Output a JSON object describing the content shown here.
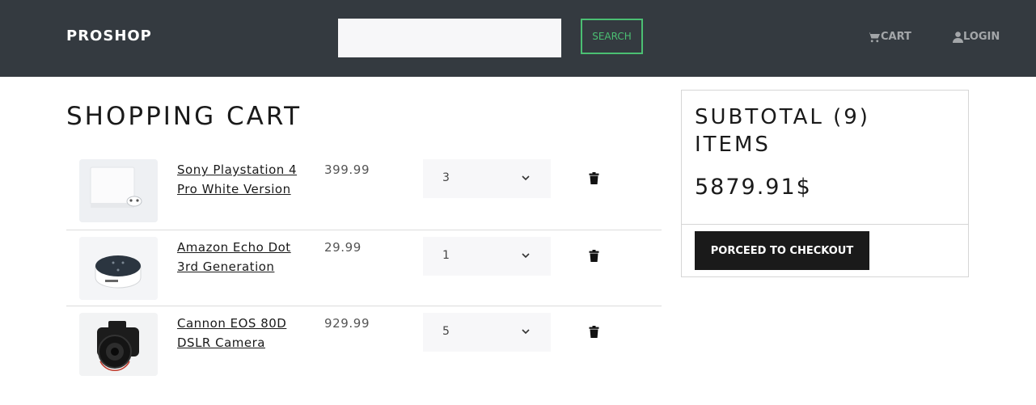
{
  "navbar": {
    "brand": "PROSHOP",
    "search": {
      "value": "",
      "placeholder": "",
      "button_label": "SEARCH"
    },
    "cart_label": "CART",
    "login_label": "LOGIN",
    "icons": {
      "cart": "cart-icon",
      "login": "user-icon"
    }
  },
  "cart": {
    "title": "SHOPPING CART",
    "items": [
      {
        "name": "Sony Playstation 4 Pro White Version",
        "price": "399.99",
        "qty": "3",
        "image": "playstation-image"
      },
      {
        "name": "Amazon Echo Dot 3rd Generation",
        "price": "29.99",
        "qty": "1",
        "image": "echo-dot-image"
      },
      {
        "name": "Cannon EOS 80D DSLR Camera",
        "price": "929.99",
        "qty": "5",
        "image": "camera-image"
      }
    ]
  },
  "summary": {
    "title": "SUBTOTAL (9) ITEMS",
    "total": "5879.91$",
    "checkout_label": "PORCEED TO CHECKOUT"
  },
  "colors": {
    "navbar_bg": "#343a40",
    "accent_green": "#4bbf73",
    "button_dark": "#1a1a1a",
    "input_bg": "#f7f7f9"
  }
}
